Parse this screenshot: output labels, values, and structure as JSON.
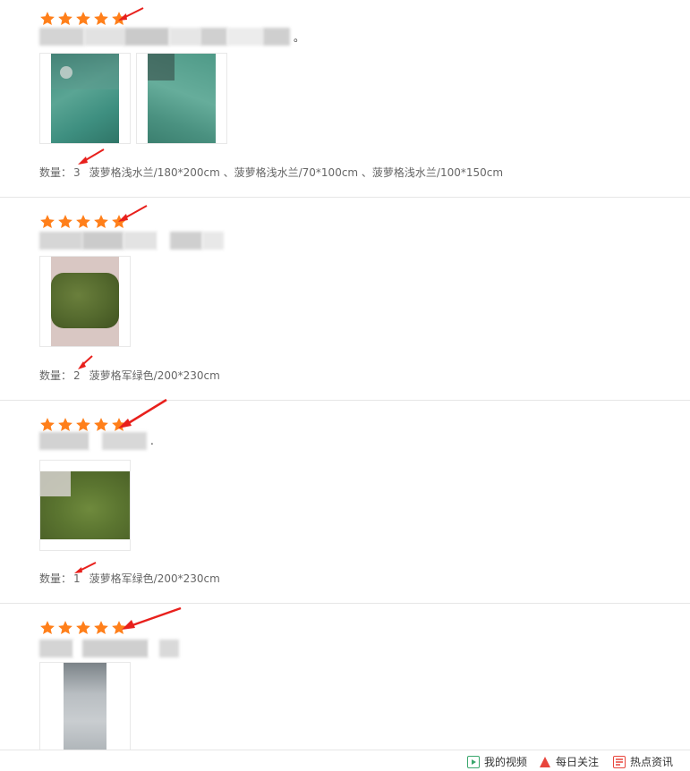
{
  "colors": {
    "star": "#ff7f1a",
    "arrow": "#e8201c",
    "text": "#666666",
    "divider": "#e6e6e6"
  },
  "reviews": [
    {
      "rating": 5,
      "trailing_char": "。",
      "quantity_label": "数量：",
      "quantity": "3",
      "spec": "菠萝格浅水兰/180*200cm 、菠萝格浅水兰/70*100cm 、菠萝格浅水兰/100*150cm",
      "photo_count": 2
    },
    {
      "rating": 5,
      "trailing_char": "",
      "quantity_label": "数量：",
      "quantity": "2",
      "spec": "菠萝格军绿色/200*230cm",
      "photo_count": 1
    },
    {
      "rating": 5,
      "trailing_char": ".",
      "quantity_label": "数量：",
      "quantity": "1",
      "spec": "菠萝格军绿色/200*230cm",
      "photo_count": 1
    },
    {
      "rating": 5,
      "trailing_char": "",
      "photo_count": 1
    }
  ],
  "bottom_bar": {
    "items": [
      {
        "label": "我的视频",
        "icon": "play-icon"
      },
      {
        "label": "每日关注",
        "icon": "follow-icon"
      },
      {
        "label": "热点资讯",
        "icon": "news-icon"
      }
    ]
  }
}
